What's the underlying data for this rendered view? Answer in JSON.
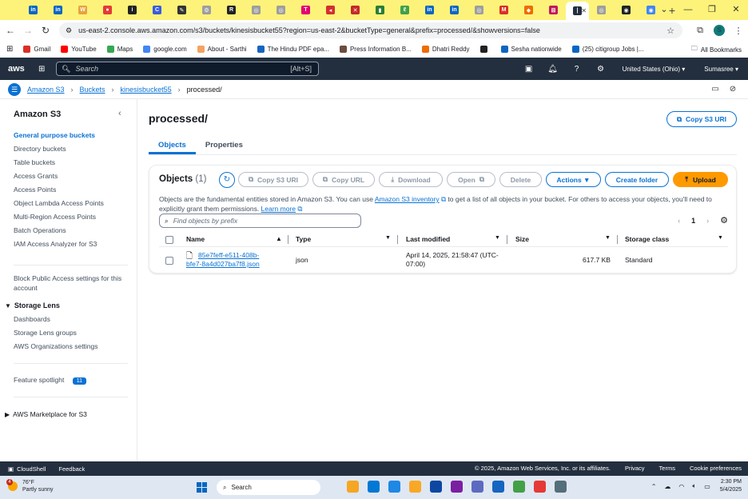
{
  "browser": {
    "tabs": [
      {
        "icon": "linkedin-icon",
        "color": "#0a66c2",
        "glyph": "in"
      },
      {
        "icon": "linkedin-icon",
        "color": "#0a66c2",
        "glyph": "in"
      },
      {
        "icon": "w-site-icon",
        "color": "#e8a33d",
        "glyph": "W"
      },
      {
        "icon": "site-icon",
        "color": "#e53935",
        "glyph": "●"
      },
      {
        "icon": "site-icon",
        "color": "#222222",
        "glyph": "i"
      },
      {
        "icon": "site-icon",
        "color": "#3b5bdb",
        "glyph": "C"
      },
      {
        "icon": "site-icon",
        "color": "#333333",
        "glyph": "✎"
      },
      {
        "icon": "site-icon",
        "color": "#9e9e9e",
        "glyph": "⚙"
      },
      {
        "icon": "site-icon",
        "color": "#222222",
        "glyph": "R"
      },
      {
        "icon": "globe-icon",
        "color": "#9e9e9e",
        "glyph": "◎"
      },
      {
        "icon": "globe-icon",
        "color": "#9e9e9e",
        "glyph": "◎"
      },
      {
        "icon": "tmobile-icon",
        "color": "#e20074",
        "glyph": "T"
      },
      {
        "icon": "site-icon",
        "color": "#d32f2f",
        "glyph": "◂"
      },
      {
        "icon": "site-icon",
        "color": "#c62828",
        "glyph": "✕"
      },
      {
        "icon": "site-icon",
        "color": "#2e7d32",
        "glyph": "▮"
      },
      {
        "icon": "site-icon",
        "color": "#43a047",
        "glyph": "ℓ"
      },
      {
        "icon": "linkedin-icon",
        "color": "#0a66c2",
        "glyph": "in"
      },
      {
        "icon": "linkedin-icon",
        "color": "#0a66c2",
        "glyph": "in"
      },
      {
        "icon": "globe-icon",
        "color": "#9e9e9e",
        "glyph": "◎"
      },
      {
        "icon": "gmail-icon",
        "color": "#d93025",
        "glyph": "M"
      },
      {
        "icon": "site-icon",
        "color": "#ef6c00",
        "glyph": "◆"
      },
      {
        "icon": "site-icon",
        "color": "#c2185b",
        "glyph": "⊠"
      },
      {
        "icon": "aws-icon",
        "color": "#232f3e",
        "glyph": "|"
      },
      {
        "icon": "globe-icon",
        "color": "#9e9e9e",
        "glyph": "◎"
      },
      {
        "icon": "site-icon",
        "color": "#222222",
        "glyph": "◉"
      },
      {
        "icon": "chrome-icon",
        "color": "#4285f4",
        "glyph": "◉"
      }
    ],
    "url": "us-east-2.console.aws.amazon.com/s3/buckets/kinesisbucket55?region=us-east-2&bucketType=general&prefix=processed/&showversions=false",
    "profile_initial": "S",
    "bookmarks": [
      {
        "label": "Gmail",
        "color": "#d93025"
      },
      {
        "label": "YouTube",
        "color": "#ff0000"
      },
      {
        "label": "Maps",
        "color": "#34a853"
      },
      {
        "label": "google.com",
        "color": "#4285f4"
      },
      {
        "label": "About - Sarthi",
        "color": "#f4a261"
      },
      {
        "label": "The Hindu PDF epa...",
        "color": "#1565c0"
      },
      {
        "label": "Press Information B...",
        "color": "#6d4c41"
      },
      {
        "label": "Dhatri Reddy",
        "color": "#ef6c00"
      },
      {
        "label": "",
        "color": "#222222"
      },
      {
        "label": "Sesha nationwide",
        "color": "#0a66c2"
      },
      {
        "label": "(25) citigroup Jobs |...",
        "color": "#0a66c2"
      }
    ],
    "all_bookmarks": "All Bookmarks"
  },
  "aws": {
    "logo": "aws",
    "search_placeholder": "Search",
    "search_shortcut": "[Alt+S]",
    "region": "United States (Ohio) ▾",
    "user": "Sumasree ▾"
  },
  "breadcrumb": {
    "items": [
      "Amazon S3",
      "Buckets",
      "kinesisbucket55"
    ],
    "current": "processed/"
  },
  "sidebar": {
    "title": "Amazon S3",
    "items": [
      {
        "label": "General purpose buckets",
        "active": true
      },
      {
        "label": "Directory buckets"
      },
      {
        "label": "Table buckets"
      },
      {
        "label": "Access Grants"
      },
      {
        "label": "Access Points"
      },
      {
        "label": "Object Lambda Access Points"
      },
      {
        "label": "Multi-Region Access Points"
      },
      {
        "label": "Batch Operations"
      },
      {
        "label": "IAM Access Analyzer for S3"
      }
    ],
    "block_public": "Block Public Access settings for this account",
    "storage_lens": "Storage Lens",
    "storage_lens_items": [
      "Dashboards",
      "Storage Lens groups",
      "AWS Organizations settings"
    ],
    "feature_spotlight": "Feature spotlight",
    "feature_badge": "11",
    "marketplace": "AWS Marketplace for S3"
  },
  "main": {
    "title": "processed/",
    "copy_uri": "Copy S3 URI",
    "tabs": [
      "Objects",
      "Properties"
    ],
    "panel": {
      "title": "Objects",
      "count": "(1)",
      "buttons": {
        "copy_uri": "Copy S3 URI",
        "copy_url": "Copy URL",
        "download": "Download",
        "open": "Open",
        "delete": "Delete",
        "actions": "Actions ▼",
        "create_folder": "Create folder",
        "upload": "Upload"
      },
      "desc_1": "Objects are the fundamental entities stored in Amazon S3. You can use ",
      "desc_link": "Amazon S3 inventory",
      "desc_2": " to get a list of all objects in your bucket. For others to access your objects, you'll need to explicitly grant them permissions. ",
      "learn_more": "Learn more",
      "filter_placeholder": "Find objects by prefix",
      "page": "1",
      "columns": [
        "Name",
        "Type",
        "Last modified",
        "Size",
        "Storage class"
      ],
      "rows": [
        {
          "name_1": "85e7feff-e511-408b-",
          "name_2": "bfe7-8a4d027ba7f8.json",
          "type": "json",
          "modified_1": "April 14, 2025, 21:58:47 (UTC-",
          "modified_2": "07:00)",
          "size": "617.7 KB",
          "storage_class": "Standard"
        }
      ]
    }
  },
  "footer": {
    "cloudshell": "CloudShell",
    "feedback": "Feedback",
    "copyright": "© 2025, Amazon Web Services, Inc. or its affiliates.",
    "privacy": "Privacy",
    "terms": "Terms",
    "cookies": "Cookie preferences"
  },
  "taskbar": {
    "weather_badge": "4",
    "temp": "76°F",
    "condition": "Partly sunny",
    "search": "Search",
    "apps": [
      "#f5a623",
      "#0078d4",
      "#1e88e5",
      "#f9a825",
      "#0d47a1",
      "#7b1fa2",
      "#5c6bc0",
      "#1565c0",
      "#43a047",
      "#e53935",
      "#546e7a"
    ],
    "time": "2:30 PM",
    "date": "5/4/2025"
  }
}
